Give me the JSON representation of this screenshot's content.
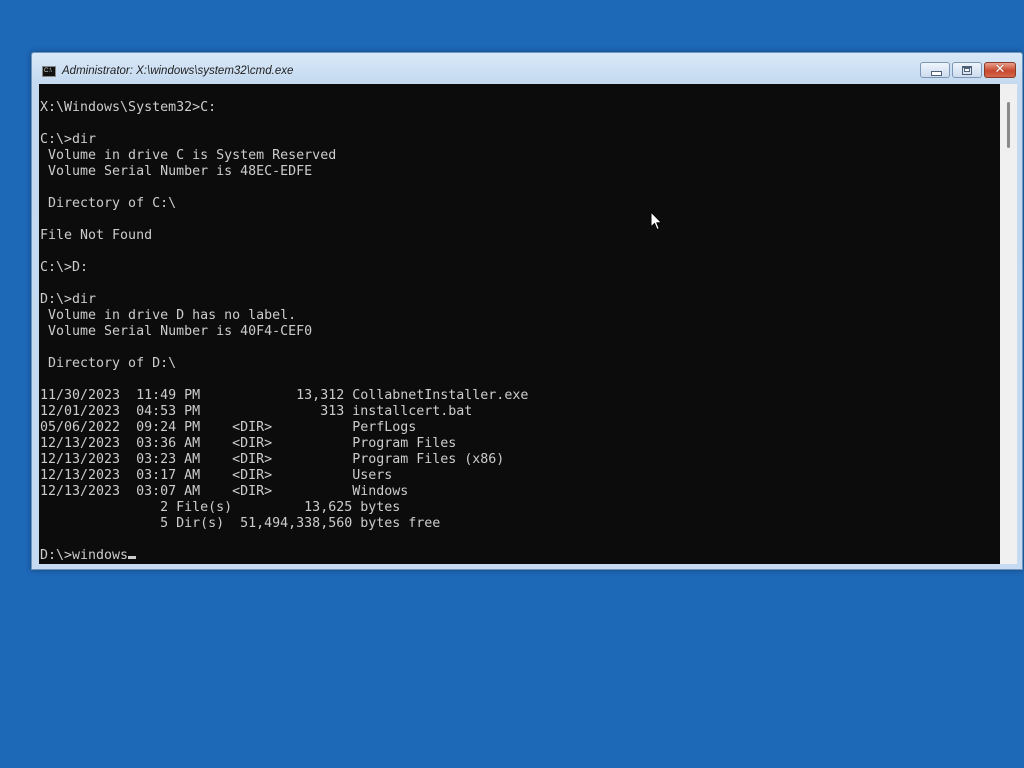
{
  "desktop": {
    "background_color": "#1e68b8"
  },
  "window": {
    "title": "Administrator: X:\\windows\\system32\\cmd.exe",
    "icon": "cmd-icon",
    "icon_text": "C:\\",
    "buttons": {
      "minimize": "minimize-icon",
      "maximize": "maximize-icon",
      "close": "close-icon",
      "close_glyph": "✕"
    }
  },
  "console": {
    "lines": [
      "X:\\Windows\\System32>C:",
      "",
      "C:\\>dir",
      " Volume in drive C is System Reserved",
      " Volume Serial Number is 48EC-EDFE",
      "",
      " Directory of C:\\",
      "",
      "File Not Found",
      "",
      "C:\\>D:",
      "",
      "D:\\>dir",
      " Volume in drive D has no label.",
      " Volume Serial Number is 40F4-CEF0",
      "",
      " Directory of D:\\",
      "",
      "11/30/2023  11:49 PM            13,312 CollabnetInstaller.exe",
      "12/01/2023  04:53 PM               313 installcert.bat",
      "05/06/2022  09:24 PM    <DIR>          PerfLogs",
      "12/13/2023  03:36 AM    <DIR>          Program Files",
      "12/13/2023  03:23 AM    <DIR>          Program Files (x86)",
      "12/13/2023  03:17 AM    <DIR>          Users",
      "12/13/2023  03:07 AM    <DIR>          Windows",
      "               2 File(s)         13,625 bytes",
      "               5 Dir(s)  51,494,338,560 bytes free"
    ],
    "prompt": "D:\\>windows",
    "text_color": "#cccccc",
    "background_color": "#0c0c0c"
  },
  "pointer": {
    "icon": "mouse-pointer-icon"
  }
}
